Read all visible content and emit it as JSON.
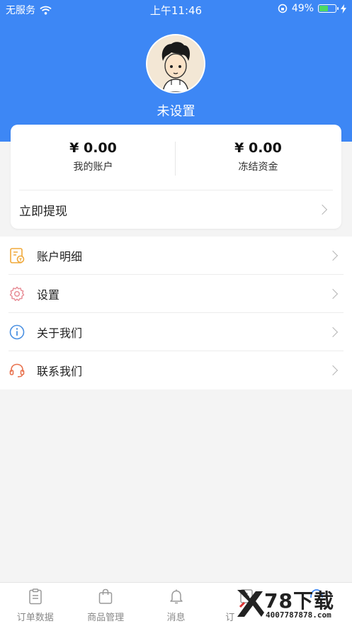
{
  "status_bar": {
    "carrier": "无服务",
    "time": "上午11:46",
    "battery_percent": "49%",
    "battery_level": 0.49,
    "accent_color": "#4cd964"
  },
  "profile": {
    "avatar_icon": "cartoon-boy-avatar",
    "name": "未设置"
  },
  "wallet": {
    "account": {
      "amount": "¥ 0.00",
      "label": "我的账户"
    },
    "frozen": {
      "amount": "¥ 0.00",
      "label": "冻结资金"
    },
    "withdraw_label": "立即提现"
  },
  "menu": [
    {
      "label": "账户明细",
      "icon": "account-detail-icon",
      "color": "#f0a93a"
    },
    {
      "label": "设置",
      "icon": "settings-gear-icon",
      "color": "#e88f98"
    },
    {
      "label": "关于我们",
      "icon": "info-icon",
      "color": "#4a90e2"
    },
    {
      "label": "联系我们",
      "icon": "headset-icon",
      "color": "#e8724e"
    }
  ],
  "tabbar": {
    "tabs": [
      {
        "label": "订单数据",
        "icon": "clipboard-icon"
      },
      {
        "label": "商品管理",
        "icon": "shopping-bag-icon"
      },
      {
        "label": "消息",
        "icon": "bell-icon"
      },
      {
        "label": "订",
        "icon": "order-list-icon"
      },
      {
        "label": "",
        "icon": "profile-icon",
        "active": true
      }
    ]
  },
  "watermark": {
    "title": "78下载",
    "subtitle": "4007787878.com"
  },
  "colors": {
    "brand_blue": "#3d87f5",
    "background": "#f4f4f4"
  }
}
